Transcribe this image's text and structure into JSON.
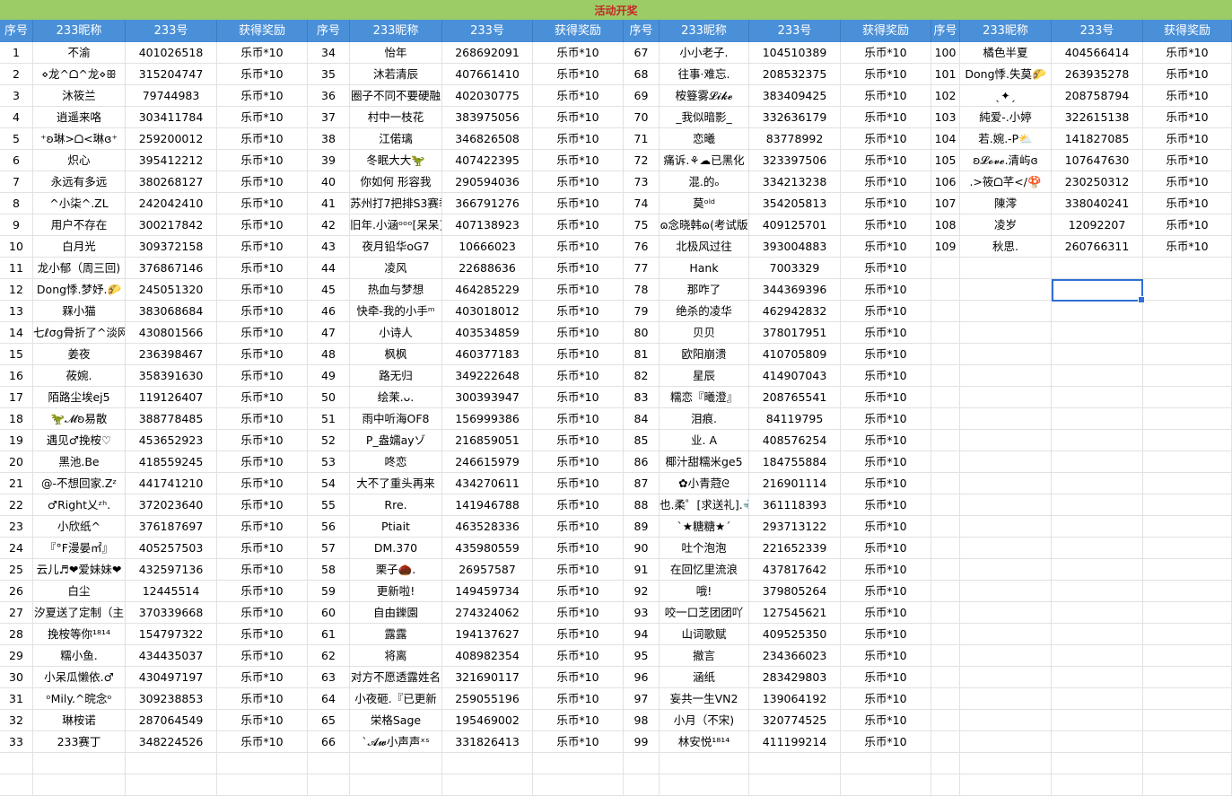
{
  "title": "活动开奖",
  "headers": [
    "序号",
    "233昵称",
    "233号",
    "获得奖励",
    "序号",
    "233昵称",
    "233号",
    "获得奖励",
    "序号",
    "233昵称",
    "233号",
    "获得奖励",
    "序号",
    "233昵称",
    "233号",
    "获得奖励"
  ],
  "colors": {
    "title_bg": "#9ccc65",
    "title_text": "#c62828",
    "header_bg": "#4a90d9",
    "selection": "#2f6fd6"
  },
  "rows": [
    [
      "1",
      "不渝",
      "401026518",
      "乐币*10",
      "34",
      "怡年",
      "268692091",
      "乐币*10",
      "67",
      "小小老子.",
      "104510389",
      "乐币*10",
      "100",
      "橘色半夏",
      "404566414",
      "乐币*10"
    ],
    [
      "2",
      "⋄龙^ᗝ^龙⋄ꕥ",
      "315204747",
      "乐币*10",
      "35",
      "沐若清辰",
      "407661410",
      "乐币*10",
      "68",
      "往事·难忘.",
      "208532375",
      "乐币*10",
      "101",
      "Dong悸.失莫🌮",
      "263935278",
      "乐币*10"
    ],
    [
      "3",
      "沐筱兰",
      "79744983",
      "乐币*10",
      "36",
      "圈子不同不要硬融",
      "402030775",
      "乐币*10",
      "69",
      "桉簦雾𝓛𝓲𝓴𝓮",
      "383409425",
      "乐币*10",
      "102",
      "ˎ✦ˏ",
      "208758794",
      "乐币*10"
    ],
    [
      "4",
      "逍遥来咯",
      "303411784",
      "乐币*10",
      "37",
      "村中一枝花",
      "383975056",
      "乐币*10",
      "70",
      "_我似暗影_",
      "332636179",
      "乐币*10",
      "103",
      "純爱-.小婷",
      "322615138",
      "乐币*10"
    ],
    [
      "5",
      "⁺ʚ琳>ᗝ<琳ɞ⁺",
      "259200012",
      "乐币*10",
      "38",
      "江偌璃",
      "346826508",
      "乐币*10",
      "71",
      "恋曦",
      "83778992",
      "乐币*10",
      "104",
      "若.婉.-P⛅",
      "141827085",
      "乐币*10"
    ],
    [
      "6",
      "炽心",
      "395412212",
      "乐币*10",
      "39",
      "冬眠大大🦖",
      "407422395",
      "乐币*10",
      "72",
      "痛诉.⚘☁已黑化",
      "323397506",
      "乐币*10",
      "105",
      "ʚ𝓛𝓸𝓿𝓮.清屿ɞ",
      "107647630",
      "乐币*10"
    ],
    [
      "7",
      "永远有多远",
      "380268127",
      "乐币*10",
      "40",
      "你如何 形容我",
      "290594036",
      "乐币*10",
      "73",
      "混.的ₒ",
      "334213238",
      "乐币*10",
      "106",
      ".>筱ᗝ芊</🍄",
      "230250312",
      "乐币*10"
    ],
    [
      "8",
      "^小柒^.ZL",
      "242042410",
      "乐币*10",
      "41",
      "苏州打7把排S3赛季",
      "366791276",
      "乐币*10",
      "74",
      "莫ᵒˡᵈ",
      "354205813",
      "乐币*10",
      "107",
      "陳澪",
      "338040241",
      "乐币*10"
    ],
    [
      "9",
      "用户不存在",
      "300217842",
      "乐币*10",
      "42",
      "旧年.小涵ᵒᵒᵒ[呆呆]",
      "407138923",
      "乐币*10",
      "75",
      "ɷ念晓韩ɷ(考试版",
      "409125701",
      "乐币*10",
      "108",
      "凌岁",
      "12092207",
      "乐币*10"
    ],
    [
      "10",
      "白月光",
      "309372158",
      "乐币*10",
      "43",
      "夜月铅华oG7",
      "10666023",
      "乐币*10",
      "76",
      "北极风过往",
      "393004883",
      "乐币*10",
      "109",
      "秋思.",
      "260766311",
      "乐币*10"
    ],
    [
      "11",
      "龙小郁（周三回)",
      "376867146",
      "乐币*10",
      "44",
      "凌风",
      "22688636",
      "乐币*10",
      "77",
      "Hank",
      "7003329",
      "乐币*10",
      "",
      "",
      "",
      ""
    ],
    [
      "12",
      "Dong悸.梦妤.🌮",
      "245051320",
      "乐币*10",
      "45",
      "热血与梦想",
      "464285229",
      "乐币*10",
      "78",
      "那咋了",
      "344369396",
      "乐币*10",
      "",
      "",
      "",
      ""
    ],
    [
      "13",
      "槑小猫",
      "383068684",
      "乐币*10",
      "46",
      "快牵-我的小手ᵐ",
      "403018012",
      "乐币*10",
      "79",
      "绝杀的凌华",
      "462942832",
      "乐币*10",
      "",
      "",
      "",
      ""
    ],
    [
      "14",
      "七ℓσg骨折了^淡网",
      "430801566",
      "乐币*10",
      "47",
      "小诗人",
      "403534859",
      "乐币*10",
      "80",
      "贝贝",
      "378017951",
      "乐币*10",
      "",
      "",
      "",
      ""
    ],
    [
      "15",
      "姜夜",
      "236398467",
      "乐币*10",
      "48",
      "枫枫",
      "460377183",
      "乐币*10",
      "81",
      "欧阳崩溃",
      "410705809",
      "乐币*10",
      "",
      "",
      "",
      ""
    ],
    [
      "16",
      "莜婉.",
      "358391630",
      "乐币*10",
      "49",
      "路无归",
      "349222648",
      "乐币*10",
      "82",
      "星辰",
      "414907043",
      "乐币*10",
      "",
      "",
      "",
      ""
    ],
    [
      "17",
      "陌路尘埃ej5",
      "119126407",
      "乐币*10",
      "50",
      "绘茉.ᴗ.",
      "300393947",
      "乐币*10",
      "83",
      "糯恋『曦澄』",
      "208765541",
      "乐币*10",
      "",
      "",
      "",
      ""
    ],
    [
      "18",
      "🦖𝓜ʚ易散",
      "388778485",
      "乐币*10",
      "51",
      "雨中听海OF8",
      "156999386",
      "乐币*10",
      "84",
      "泪痕.",
      "84119795",
      "乐币*10",
      "",
      "",
      "",
      ""
    ],
    [
      "19",
      "遇见♂挽桉♡",
      "453652923",
      "乐币*10",
      "52",
      "P_盎嬬ayゾ",
      "216859051",
      "乐币*10",
      "85",
      "业. A",
      "408576254",
      "乐币*10",
      "",
      "",
      "",
      ""
    ],
    [
      "20",
      "黑池.Be",
      "418559245",
      "乐币*10",
      "53",
      "咚恋",
      "246615979",
      "乐币*10",
      "86",
      "椰汁甜糯米ge5",
      "184755884",
      "乐币*10",
      "",
      "",
      "",
      ""
    ],
    [
      "21",
      "@-不想回家.Zᶻ",
      "441741210",
      "乐币*10",
      "54",
      "大不了重头再来",
      "434270611",
      "乐币*10",
      "87",
      "✿小青蒄ᘓ",
      "216901114",
      "乐币*10",
      "",
      "",
      "",
      ""
    ],
    [
      "22",
      "♂Right乂ᶻʰ.",
      "372023640",
      "乐币*10",
      "55",
      "Rre.",
      "141946788",
      "乐币*10",
      "88",
      "也.柔゜[求送礼].🐳",
      "361118393",
      "乐币*10",
      "",
      "",
      "",
      ""
    ],
    [
      "23",
      "小欣纸^",
      "376187697",
      "乐币*10",
      "56",
      "Ptiait",
      "463528336",
      "乐币*10",
      "89",
      "ˋ★糖糖★ˊ",
      "293713122",
      "乐币*10",
      "",
      "",
      "",
      ""
    ],
    [
      "24",
      "『°F漫晏㎡』",
      "405257503",
      "乐币*10",
      "57",
      "DM.370",
      "435980559",
      "乐币*10",
      "90",
      "吐个泡泡",
      "221652339",
      "乐币*10",
      "",
      "",
      "",
      ""
    ],
    [
      "25",
      "云儿♬❤爱妹妹❤",
      "432597136",
      "乐币*10",
      "58",
      "栗子🌰.",
      "26957587",
      "乐币*10",
      "91",
      "在回忆里流浪",
      "437817642",
      "乐币*10",
      "",
      "",
      "",
      ""
    ],
    [
      "26",
      "白尘",
      "12445514",
      "乐币*10",
      "59",
      "更新啦!",
      "149459734",
      "乐币*10",
      "92",
      "哦!",
      "379805264",
      "乐币*10",
      "",
      "",
      "",
      ""
    ],
    [
      "27",
      "汐夏送了定制（主",
      "370339668",
      "乐币*10",
      "60",
      "自由鑠園",
      "274324062",
      "乐币*10",
      "93",
      "咬一口芝团团吖",
      "127545621",
      "乐币*10",
      "",
      "",
      "",
      ""
    ],
    [
      "28",
      "挽桉等你¹⁸¹⁴",
      "154797322",
      "乐币*10",
      "61",
      "露露",
      "194137627",
      "乐币*10",
      "94",
      "山词歌赋",
      "409525350",
      "乐币*10",
      "",
      "",
      "",
      ""
    ],
    [
      "29",
      "糯小鱼.",
      "434435037",
      "乐币*10",
      "62",
      "将离",
      "408982354",
      "乐币*10",
      "95",
      "撤言",
      "234366023",
      "乐币*10",
      "",
      "",
      "",
      ""
    ],
    [
      "30",
      "小呆瓜懒依.♂",
      "430497197",
      "乐币*10",
      "63",
      "对方不愿透露姓名",
      "321690117",
      "乐币*10",
      "96",
      "涵纸",
      "283429803",
      "乐币*10",
      "",
      "",
      "",
      ""
    ],
    [
      "31",
      "ᵒMily.^晥念ᵒ",
      "309238853",
      "乐币*10",
      "64",
      "小夜砸.『已更新",
      "259055196",
      "乐币*10",
      "97",
      "妄共一生VN2",
      "139064192",
      "乐币*10",
      "",
      "",
      "",
      ""
    ],
    [
      "32",
      "琳桉诺",
      "287064549",
      "乐币*10",
      "65",
      "栄格Sage",
      "195469002",
      "乐币*10",
      "98",
      "小月（不宋)",
      "320774525",
      "乐币*10",
      "",
      "",
      "",
      ""
    ],
    [
      "33",
      "233赛丁",
      "348224526",
      "乐币*10",
      "66",
      "ˋ𝓐𝔀小声声ˣˢ",
      "331826413",
      "乐币*10",
      "99",
      "林安悦¹⁸¹⁴",
      "411199214",
      "乐币*10",
      "",
      "",
      "",
      ""
    ]
  ]
}
